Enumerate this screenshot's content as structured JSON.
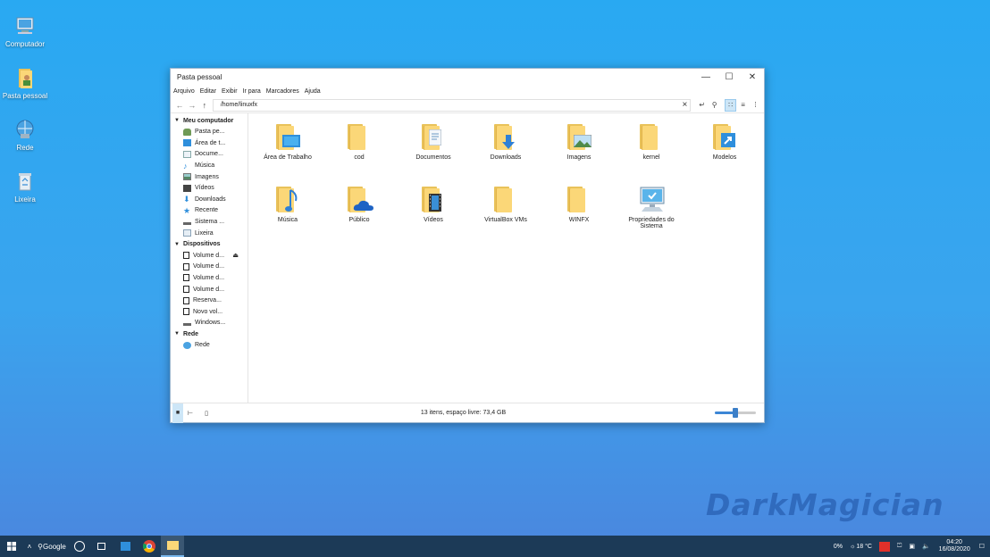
{
  "desktop": {
    "icons": [
      {
        "label": "Computador"
      },
      {
        "label": "Pasta pessoal"
      },
      {
        "label": "Rede"
      },
      {
        "label": "Lixeira"
      }
    ]
  },
  "window": {
    "title": "Pasta pessoal",
    "menu": [
      "Arquivo",
      "Editar",
      "Exibir",
      "Ir para",
      "Marcadores",
      "Ajuda"
    ],
    "address": "/home/linuxfx"
  },
  "sidebar": {
    "sections": [
      {
        "label": "Meu computador",
        "items": [
          {
            "label": "Pasta pe...",
            "icon": "user-icon"
          },
          {
            "label": "Área de t...",
            "icon": "desktop-icon"
          },
          {
            "label": "Docume...",
            "icon": "document-icon"
          },
          {
            "label": "Música",
            "icon": "music-icon"
          },
          {
            "label": "Imagens",
            "icon": "image-icon"
          },
          {
            "label": "Vídeos",
            "icon": "film-icon"
          },
          {
            "label": "Downloads",
            "icon": "download-icon"
          },
          {
            "label": "Recente",
            "icon": "star-icon"
          },
          {
            "label": "Sistema ...",
            "icon": "drive-icon"
          },
          {
            "label": "Lixeira",
            "icon": "trash-icon"
          }
        ]
      },
      {
        "label": "Dispositivos",
        "items": [
          {
            "label": "Volume d...",
            "icon": "volume-icon"
          },
          {
            "label": "Volume d...",
            "icon": "volume-icon"
          },
          {
            "label": "Volume d...",
            "icon": "volume-icon"
          },
          {
            "label": "Volume d...",
            "icon": "volume-icon"
          },
          {
            "label": "Reserva...",
            "icon": "volume-icon"
          },
          {
            "label": "Novo vol...",
            "icon": "volume-icon"
          },
          {
            "label": "Windows...",
            "icon": "drive-icon"
          }
        ]
      },
      {
        "label": "Rede",
        "items": [
          {
            "label": "Rede",
            "icon": "network-icon"
          }
        ]
      }
    ]
  },
  "files": [
    {
      "label": "Área de Trabalho",
      "kind": "folder",
      "badge": "desktop"
    },
    {
      "label": "cod",
      "kind": "folder",
      "badge": ""
    },
    {
      "label": "Documentos",
      "kind": "folder",
      "badge": "document"
    },
    {
      "label": "Downloads",
      "kind": "folder",
      "badge": "download"
    },
    {
      "label": "Imagens",
      "kind": "folder",
      "badge": "image"
    },
    {
      "label": "kernel",
      "kind": "folder",
      "badge": ""
    },
    {
      "label": "Modelos",
      "kind": "folder",
      "badge": "shortcut"
    },
    {
      "label": "Música",
      "kind": "folder",
      "badge": "music"
    },
    {
      "label": "Público",
      "kind": "folder",
      "badge": "cloud"
    },
    {
      "label": "Vídeos",
      "kind": "folder",
      "badge": "film"
    },
    {
      "label": "VirtualBox VMs",
      "kind": "folder",
      "badge": ""
    },
    {
      "label": "WINFX",
      "kind": "folder",
      "badge": ""
    },
    {
      "label": "Propriedades do Sistema",
      "kind": "computer",
      "badge": ""
    }
  ],
  "status": {
    "text": "13 itens, espaço livre: 73,4 GB",
    "zoom": 0.5
  },
  "taskbar": {
    "search_label": "Google",
    "battery": "0%",
    "temperature": "18 °C",
    "time": "04:20",
    "date": "16/08/2020"
  },
  "watermark": "DarkMagician",
  "colors": {
    "accent": "#3c86d6",
    "folder": "#fbd778",
    "taskbar": "#1c3a57"
  }
}
